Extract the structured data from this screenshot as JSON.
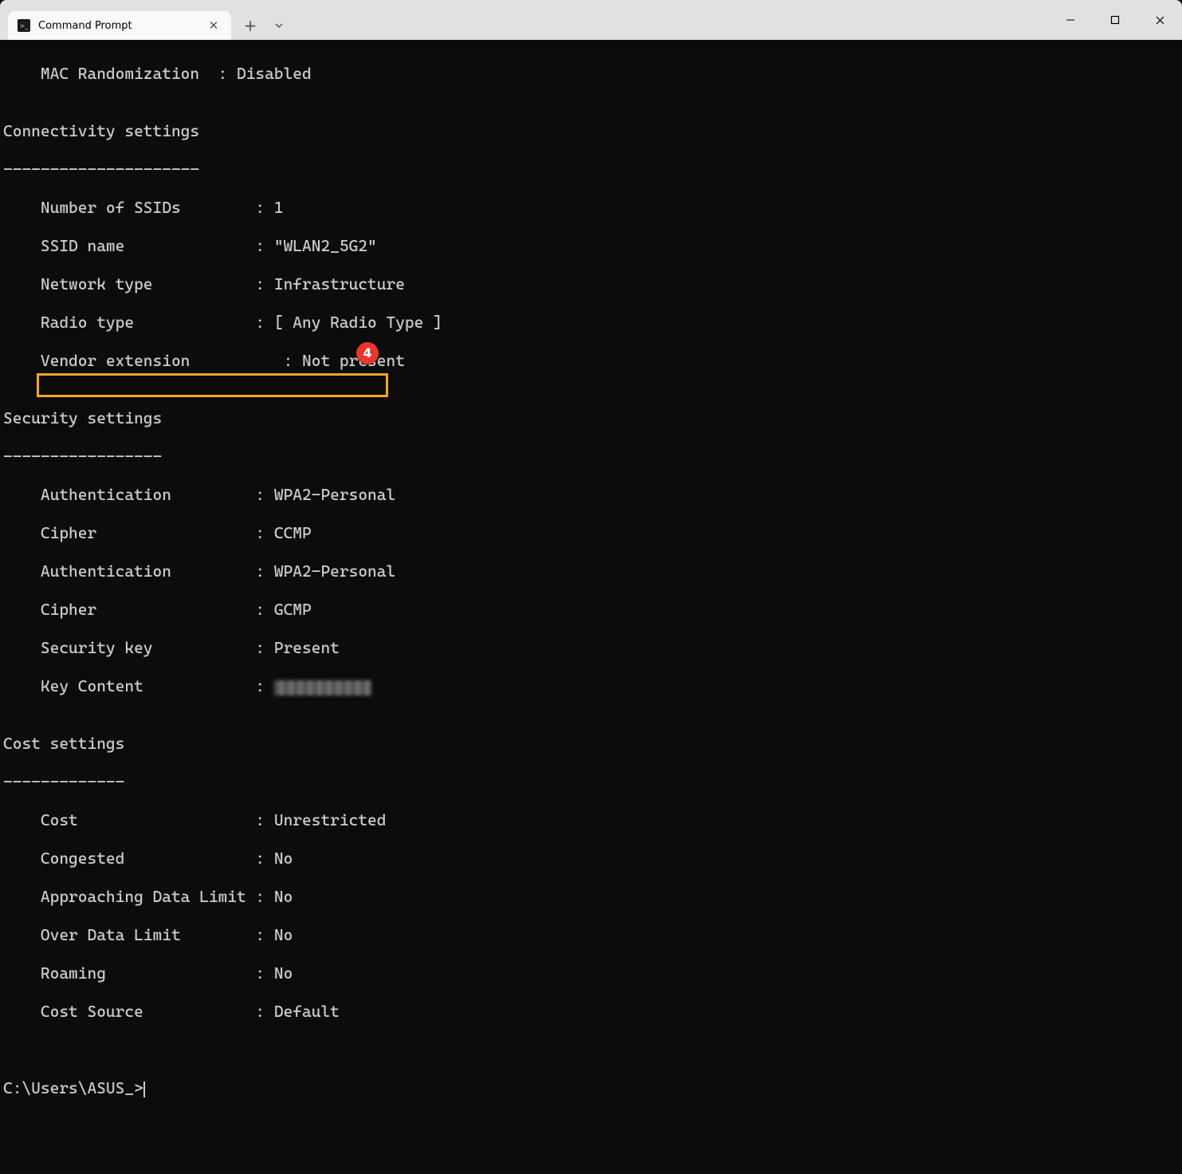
{
  "titlebar": {
    "tab_title": "Command Prompt"
  },
  "annotation": {
    "badge_number": "4"
  },
  "terminal": {
    "line0": "    MAC Randomization  : Disabled",
    "blank1": "",
    "conn_hdr": "Connectivity settings",
    "conn_sep": "---------------------",
    "l1": "    Number of SSIDs        : 1",
    "l2": "    SSID name              : \"WLAN2_5G2\"",
    "l3": "    Network type           : Infrastructure",
    "l4": "    Radio type             : [ Any Radio Type ]",
    "l5": "    Vendor extension          : Not present",
    "blank2": "",
    "sec_hdr": "Security settings",
    "sec_sep": "-----------------",
    "s1": "    Authentication         : WPA2-Personal",
    "s2": "    Cipher                 : CCMP",
    "s3": "    Authentication         : WPA2-Personal",
    "s4": "    Cipher                 : GCMP",
    "s5": "    Security key           : Present",
    "s6a": "    Key Content            : ",
    "blank3": "",
    "cost_hdr": "Cost settings",
    "cost_sep": "-------------",
    "c1": "    Cost                   : Unrestricted",
    "c2": "    Congested              : No",
    "c3": "    Approaching Data Limit : No",
    "c4": "    Over Data Limit        : No",
    "c5": "    Roaming                : No",
    "c6": "    Cost Source            : Default",
    "blank4": "",
    "blank5": "",
    "prompt": "C:\\Users\\ASUS_>"
  }
}
